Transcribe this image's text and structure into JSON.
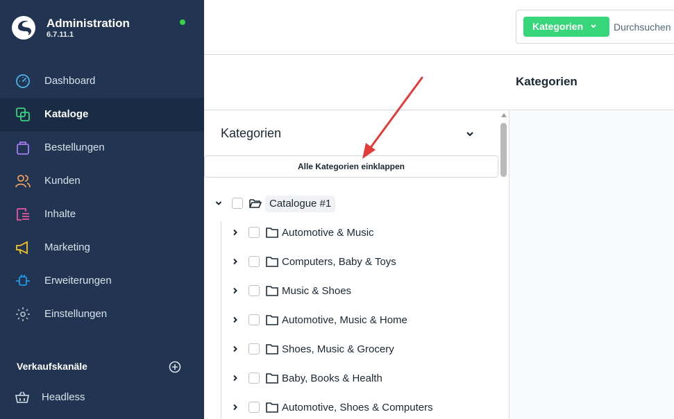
{
  "app": {
    "title": "Administration",
    "version": "6.7.11.1",
    "status_color": "#37d046"
  },
  "sidebar": {
    "items": [
      {
        "label": "Dashboard",
        "icon": "gauge-icon",
        "color": "#4fb3e8"
      },
      {
        "label": "Kataloge",
        "icon": "catalog-icon",
        "color": "#37d67a",
        "active": true
      },
      {
        "label": "Bestellungen",
        "icon": "shopping-bag-icon",
        "color": "#a57bf5"
      },
      {
        "label": "Kunden",
        "icon": "users-icon",
        "color": "#f39c5a"
      },
      {
        "label": "Inhalte",
        "icon": "content-icon",
        "color": "#e8579f"
      },
      {
        "label": "Marketing",
        "icon": "megaphone-icon",
        "color": "#f5c623"
      },
      {
        "label": "Erweiterungen",
        "icon": "plug-icon",
        "color": "#1e9be8"
      },
      {
        "label": "Einstellungen",
        "icon": "gear-icon",
        "color": "#aab4c0"
      }
    ],
    "sales_channels": {
      "heading": "Verkaufskanäle",
      "items": [
        {
          "label": "Headless",
          "icon": "basket-icon"
        }
      ]
    }
  },
  "search": {
    "type_label": "Kategorien",
    "placeholder": "Durchsuchen"
  },
  "header": {
    "title": "Kategorien"
  },
  "tree": {
    "heading": "Kategorien",
    "collapse_label": "Alle Kategorien einklappen",
    "root": {
      "label": "Catalogue #1"
    },
    "children": [
      {
        "label": "Automotive & Music"
      },
      {
        "label": "Computers, Baby & Toys"
      },
      {
        "label": "Music & Shoes"
      },
      {
        "label": "Automotive, Music & Home"
      },
      {
        "label": "Shoes, Music & Grocery"
      },
      {
        "label": "Baby, Books & Health"
      },
      {
        "label": "Automotive, Shoes & Computers"
      }
    ]
  },
  "colors": {
    "sidebar_bg": "#213552",
    "accent": "#37d67a",
    "annotation": "#e03c3c"
  }
}
